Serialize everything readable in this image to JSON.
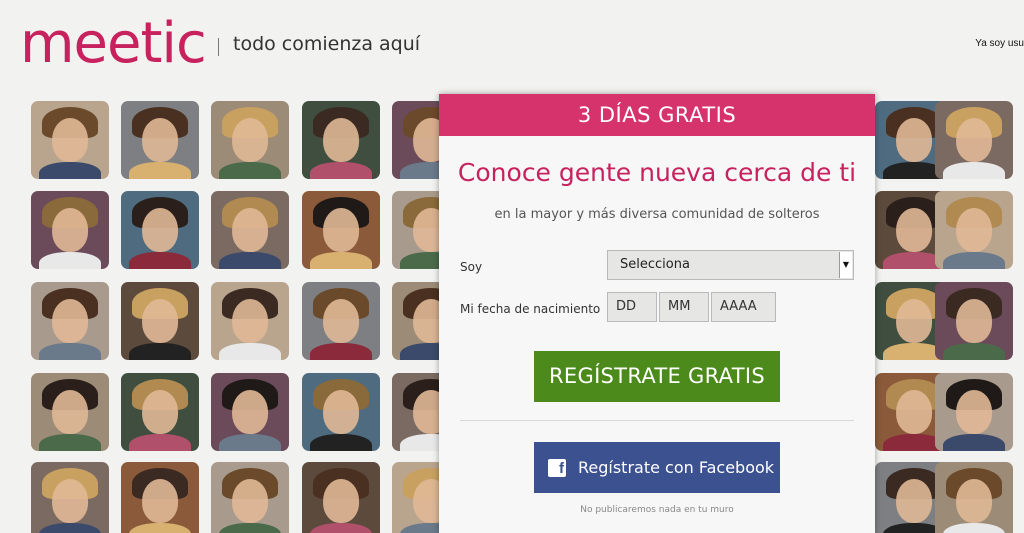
{
  "header": {
    "logo_text": "meetic",
    "tagline": "todo comienza aquí",
    "login_link": "Ya soy usu"
  },
  "modal": {
    "banner": "3 DÍAS GRATIS",
    "headline": "Conoce gente nueva cerca de ti",
    "subheadline": "en la mayor y más diversa comunidad de solteros",
    "soy_label": "Soy",
    "soy_select_value": "Selecciona",
    "birth_label": "Mi fecha de nacimiento",
    "day_placeholder": "DD",
    "month_placeholder": "MM",
    "year_placeholder": "AAAA",
    "register_button": "REGÍSTRATE GRATIS",
    "facebook_button": "Regístrate con Facebook",
    "facebook_note": "No publicaremos nada en tu muro"
  },
  "colors": {
    "brand": "#c8225e",
    "banner": "#d6336c",
    "register": "#4c8a1c",
    "facebook": "#3b5190"
  },
  "icons": {
    "facebook": "facebook-icon",
    "dropdown": "chevron-down-icon"
  }
}
